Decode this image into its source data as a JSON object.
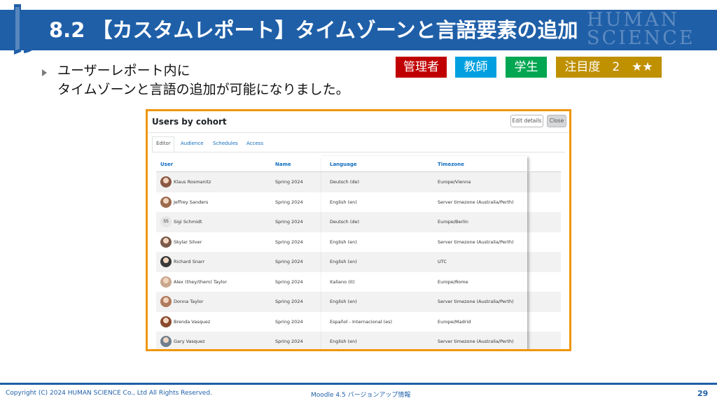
{
  "slide": {
    "title": "8.2 【カスタムレポート】タイムゾーンと言語要素の追加",
    "watermark_lines": [
      "HUMAN",
      "SCIENCE"
    ],
    "bullet_lines": [
      "ユーザーレポート内に",
      "タイムゾーンと言語の追加が可能になりました。"
    ],
    "badges": {
      "admin": "管理者",
      "teacher": "教師",
      "student": "学生",
      "attention": "注目度　2　★★"
    },
    "footer": {
      "copyright": "Copyright (C) 2024 HUMAN SCIENCE Co., Ltd All Rights Reserved.",
      "center": "Moodle 4.5 バージョンアップ情報",
      "page": "29"
    }
  },
  "report": {
    "title": "Users by cohort",
    "buttons": {
      "edit": "Edit details",
      "close": "Close"
    },
    "tabs": [
      "Editor",
      "Audience",
      "Schedules",
      "Access"
    ],
    "columns": [
      "User",
      "Name",
      "Language",
      "Timezone"
    ],
    "rows": [
      {
        "user": "Klaus Rosmanitz",
        "name": "Spring 2024",
        "language": "Deutsch (de)",
        "timezone": "Europe/Vienna",
        "avatar": "photo",
        "avatar_color": "#8b5a44"
      },
      {
        "user": "Jeffrey Sanders",
        "name": "Spring 2024",
        "language": "English (en)",
        "timezone": "Server timezone (Australia/Perth)",
        "avatar": "photo",
        "avatar_color": "#9c6b4e"
      },
      {
        "user": "Sigi Schmidt",
        "name": "Spring 2024",
        "language": "Deutsch (de)",
        "timezone": "Europe/Berlin",
        "avatar": "initials",
        "initials": "SS"
      },
      {
        "user": "Skylar Silver",
        "name": "Spring 2024",
        "language": "English (en)",
        "timezone": "Server timezone (Australia/Perth)",
        "avatar": "photo",
        "avatar_color": "#7b5a4a"
      },
      {
        "user": "Richard Snarr",
        "name": "Spring 2024",
        "language": "English (en)",
        "timezone": "UTC",
        "avatar": "photo",
        "avatar_color": "#3a3a3a"
      },
      {
        "user": "Alex (they/them) Taylor",
        "name": "Spring 2024",
        "language": "Italiano (it)",
        "timezone": "Europe/Rome",
        "avatar": "photo",
        "avatar_color": "#c9a78e"
      },
      {
        "user": "Donna Taylor",
        "name": "Spring 2024",
        "language": "English (en)",
        "timezone": "Server timezone (Australia/Perth)",
        "avatar": "photo",
        "avatar_color": "#b07a5c"
      },
      {
        "user": "Brenda Vasquez",
        "name": "Spring 2024",
        "language": "Español - Internacional (es)",
        "timezone": "Europe/Madrid",
        "avatar": "photo",
        "avatar_color": "#8a4a2c"
      },
      {
        "user": "Gary Vasquez",
        "name": "Spring 2024",
        "language": "English (en)",
        "timezone": "Server timezone (Australia/Perth)",
        "avatar": "photo",
        "avatar_color": "#6f7f8f"
      }
    ]
  },
  "colors": {
    "header_blue": "#1f5fa8",
    "frame_orange": "#f0960a",
    "link_blue": "#0f6cbf"
  }
}
